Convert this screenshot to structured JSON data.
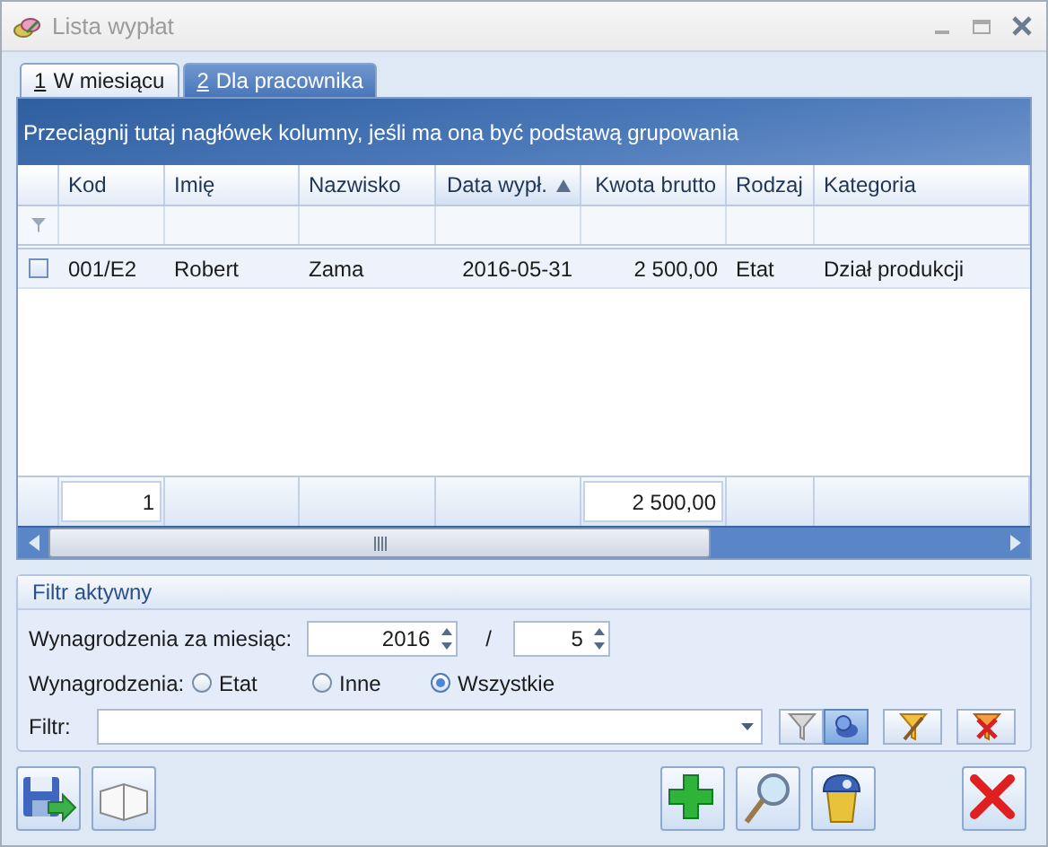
{
  "window": {
    "title": "Lista wypłat"
  },
  "tabs": [
    {
      "key": "1",
      "label": "W miesiącu",
      "selected": true
    },
    {
      "key": "2",
      "label": "Dla pracownika",
      "selected": false
    }
  ],
  "grid": {
    "group_hint": "Przeciągnij tutaj nagłówek kolumny, jeśli ma ona być podstawą grupowania",
    "columns": [
      {
        "label": "Kod",
        "right_aligned": false,
        "sorted": false,
        "total": "1"
      },
      {
        "label": "Imię",
        "right_aligned": false,
        "sorted": false
      },
      {
        "label": "Nazwisko",
        "right_aligned": false,
        "sorted": false
      },
      {
        "label": "Data wypł.",
        "right_aligned": true,
        "sorted": true
      },
      {
        "label": "Kwota brutto",
        "right_aligned": true,
        "sorted": false,
        "total": "2 500,00"
      },
      {
        "label": "Rodzaj",
        "right_aligned": false,
        "sorted": false
      },
      {
        "label": "Kategoria",
        "right_aligned": false,
        "sorted": false
      }
    ],
    "rows": [
      {
        "checked": false,
        "cells": [
          "001/E2",
          "Robert",
          "Zama",
          "2016-05-31",
          "2 500,00",
          "Etat",
          "Dział produkcji"
        ]
      }
    ]
  },
  "filter": {
    "title": "Filtr aktywny",
    "period_label": "Wynagrodzenia za miesiąc:",
    "year": "2016",
    "separator": "/",
    "month": "5",
    "type_label": "Wynagrodzenia:",
    "types": [
      {
        "label": "Etat",
        "selected": false
      },
      {
        "label": "Inne",
        "selected": false
      },
      {
        "label": "Wszystkie",
        "selected": true
      }
    ],
    "filter_label": "Filtr:",
    "tools": [
      {
        "kind": "funnel",
        "selected": false
      },
      {
        "kind": "pin",
        "selected": true
      },
      {
        "kind": "wand",
        "selected": false
      },
      {
        "kind": "clear",
        "selected": false
      }
    ]
  },
  "actions": {
    "left": [
      {
        "kind": "export"
      },
      {
        "kind": "book"
      }
    ],
    "center": [
      {
        "kind": "add"
      },
      {
        "kind": "preview"
      },
      {
        "kind": "delete"
      }
    ],
    "right": [
      {
        "kind": "close"
      }
    ]
  }
}
